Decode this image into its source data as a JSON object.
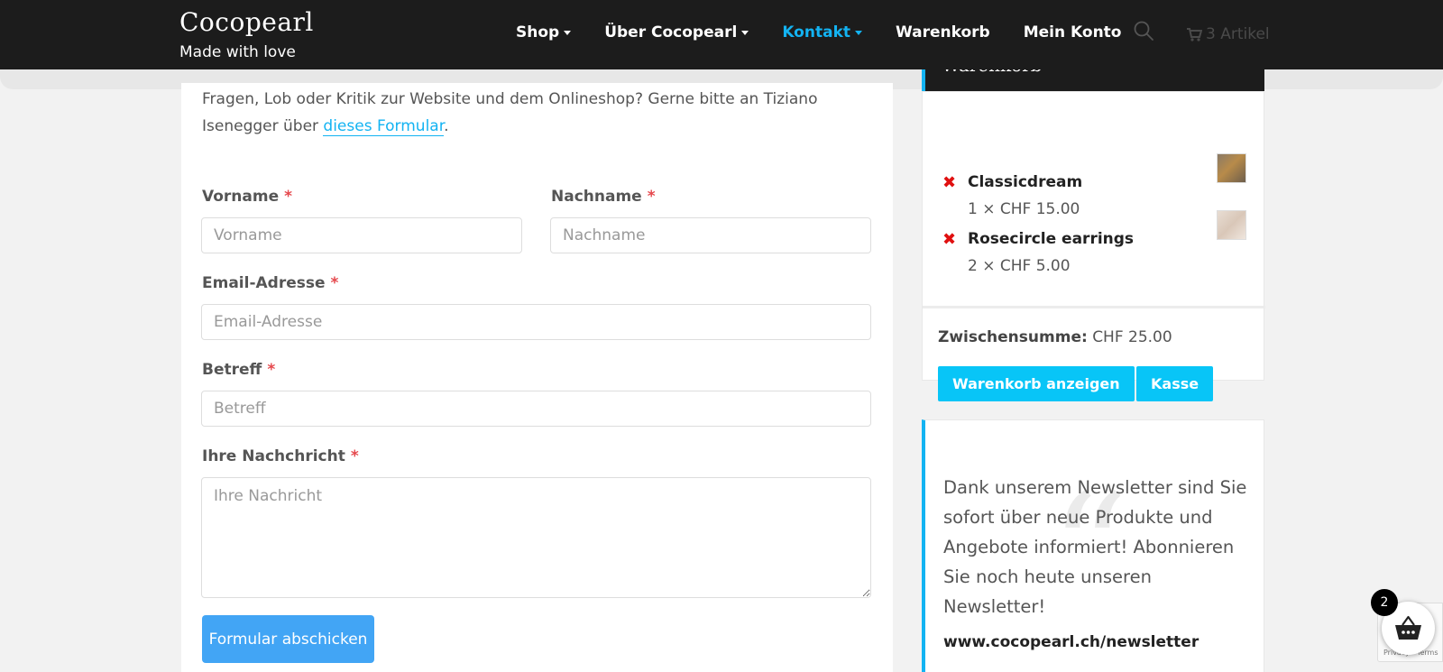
{
  "header": {
    "brand_title": "Cocopearl",
    "brand_subtitle": "Made with love",
    "nav": [
      {
        "label": "Shop",
        "dropdown": true
      },
      {
        "label": "Über Cocopearl",
        "dropdown": true
      },
      {
        "label": "Kontakt",
        "dropdown": true,
        "active": true
      },
      {
        "label": "Warenkorb",
        "dropdown": false
      },
      {
        "label": "Mein Konto",
        "dropdown": false
      }
    ],
    "cart_count_label": "3 Artikel",
    "accent_color": "#13b3f2",
    "icons": [
      "search-icon",
      "cart-icon"
    ]
  },
  "contact": {
    "intro_text": "Fragen, Lob oder Kritik zur Website und dem Onlineshop? Gerne bitte an Tiziano Isenegger über ",
    "intro_link": "dieses Formular",
    "intro_end": ".",
    "required_mark": "*",
    "fields": {
      "firstname": {
        "label": "Vorname",
        "placeholder": "Vorname"
      },
      "lastname": {
        "label": "Nachname",
        "placeholder": "Nachname"
      },
      "email": {
        "label": "Email-Adresse",
        "placeholder": "Email-Adresse"
      },
      "subject": {
        "label": "Betreff",
        "placeholder": "Betreff"
      },
      "message": {
        "label": "Ihre Nachchricht",
        "placeholder": "Ihre Nachricht"
      }
    },
    "submit_label": "Formular abschicken"
  },
  "cart_widget": {
    "title": "Warenkorb",
    "items": [
      {
        "name": "Classicdream",
        "qty": "1 × CHF 15.00"
      },
      {
        "name": "Rosecircle earrings",
        "qty": "2 × CHF 5.00"
      }
    ],
    "remove_glyph": "✖",
    "subtotal_label": "Zwischensumme:",
    "subtotal_value": "CHF 25.00",
    "view_cart_label": "Warenkorb anzeigen",
    "checkout_label": "Kasse"
  },
  "newsletter": {
    "text": "Dank unserem Newsletter sind Sie sofort über neue Produkte und Angebote informiert! Abonnieren Sie noch heute unseren Newsletter!",
    "link": "www.cocopearl.ch/newsletter"
  },
  "floating_cart": {
    "badge": "2",
    "recaptcha_text": "Privacy - Terms"
  }
}
